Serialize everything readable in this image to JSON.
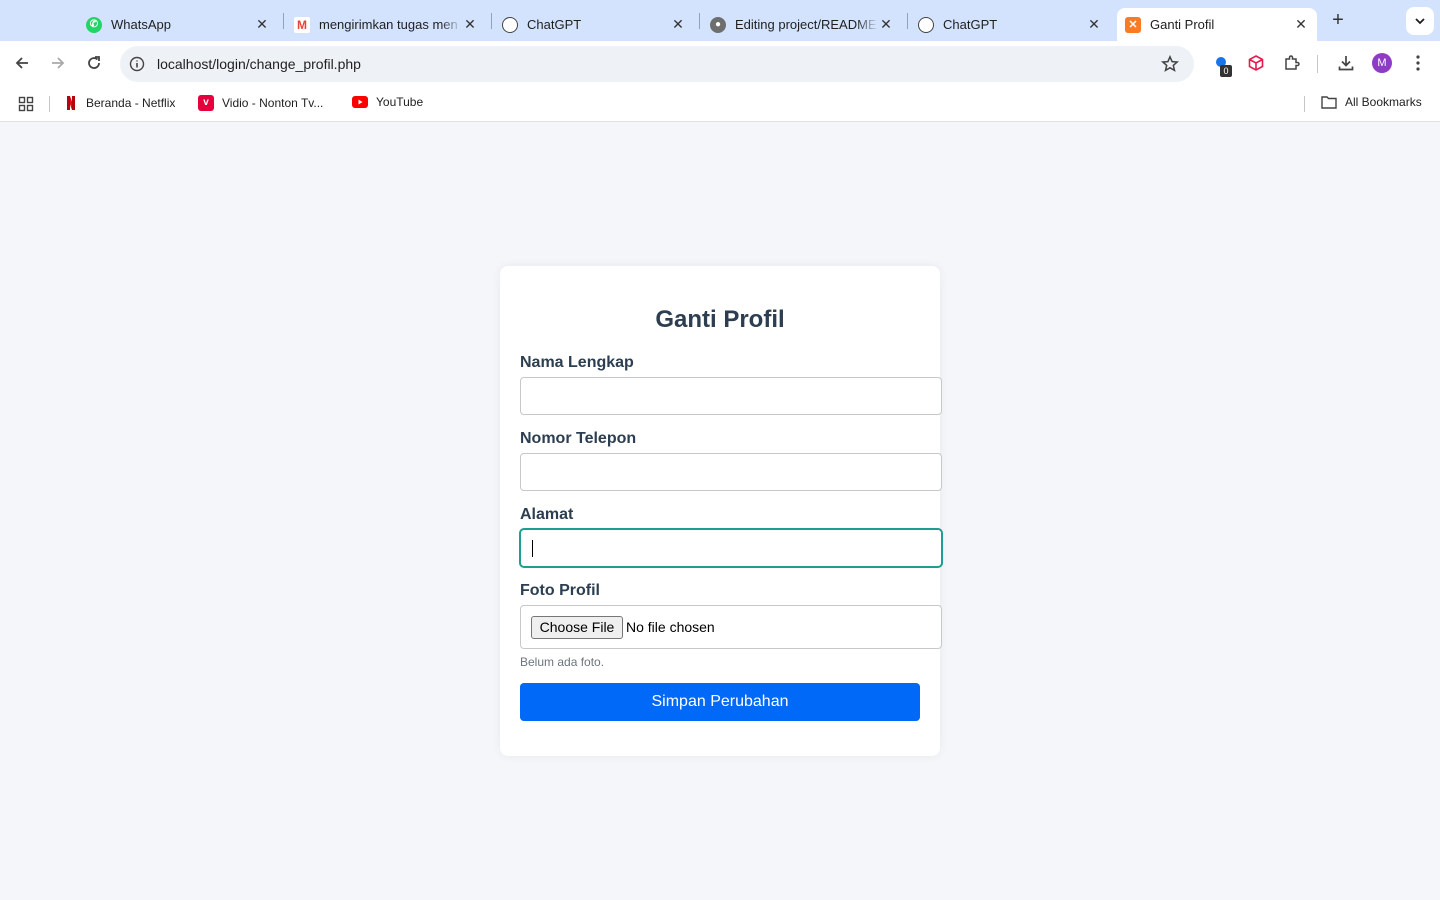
{
  "browser": {
    "tabs": [
      {
        "title": "WhatsApp",
        "icon": "whatsapp-icon",
        "color": "#25d366",
        "active": false
      },
      {
        "title": "mengirimkan tugas men",
        "icon": "gmail-icon",
        "color": "#ea4335",
        "active": false
      },
      {
        "title": "ChatGPT",
        "icon": "chatgpt-icon",
        "color": "#444444",
        "active": false
      },
      {
        "title": "Editing project/README",
        "icon": "github-icon",
        "color": "#6e6e6e",
        "active": false
      },
      {
        "title": "ChatGPT",
        "icon": "chatgpt-icon",
        "color": "#444444",
        "active": false
      },
      {
        "title": "Ganti Profil",
        "icon": "xampp-icon",
        "color": "#fb7a24",
        "active": true
      }
    ],
    "address": "localhost/login/change_profil.php",
    "extension_badge": "0",
    "profile_initial": "M",
    "bookmarks": [
      {
        "label": "Beranda - Netflix",
        "icon": "netflix-icon"
      },
      {
        "label": "Vidio - Nonton Tv...",
        "icon": "vidio-icon"
      },
      {
        "label": "YouTube",
        "icon": "youtube-icon"
      }
    ],
    "all_bookmarks": "All Bookmarks"
  },
  "form": {
    "title": "Ganti Profil",
    "fields": {
      "nama": {
        "label": "Nama Lengkap",
        "value": ""
      },
      "telepon": {
        "label": "Nomor Telepon",
        "value": ""
      },
      "alamat": {
        "label": "Alamat",
        "value": ""
      },
      "foto": {
        "label": "Foto Profil",
        "button": "Choose File",
        "status": "No file chosen"
      }
    },
    "hint": "Belum ada foto.",
    "submit": "Simpan Perubahan"
  },
  "colors": {
    "accent": "#0069f7",
    "heading": "#2c3e50",
    "focus": "#1e9e8e",
    "tab_strip": "#d3e3fd"
  }
}
